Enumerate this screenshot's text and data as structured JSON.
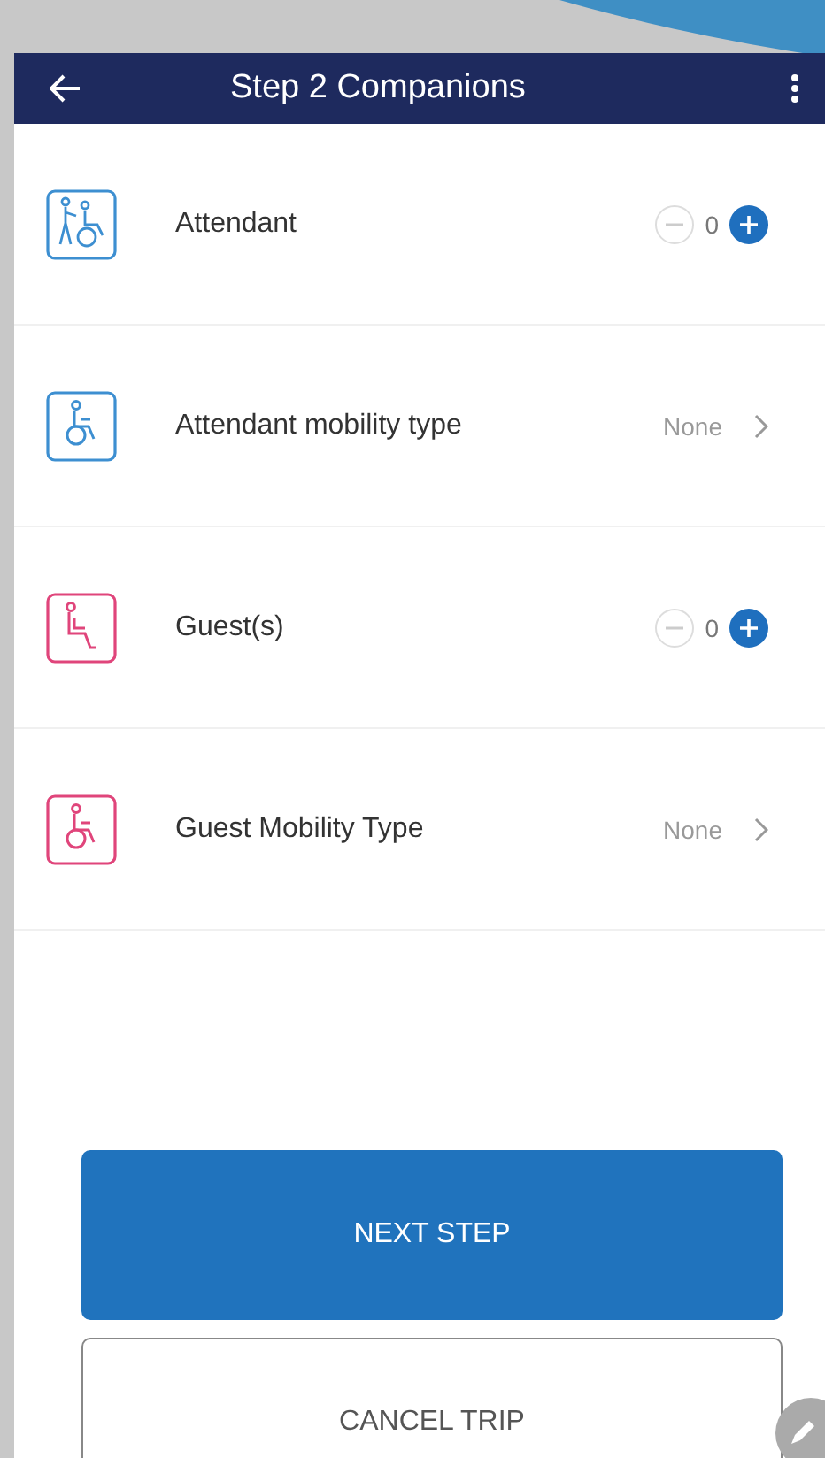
{
  "app_bar": {
    "title": "Step 2 Companions"
  },
  "rows": [
    {
      "kind": "counter",
      "icon": {
        "kind": "pusher"
      },
      "color": "#3d8fd1",
      "label": "Attendant",
      "value": "0",
      "minus_disabled": true
    },
    {
      "kind": "select",
      "icon": {
        "kind": "wheelchair"
      },
      "color": "#3d8fd1",
      "label": "Attendant mobility type",
      "value": "None"
    },
    {
      "kind": "counter",
      "icon": {
        "kind": "seat"
      },
      "color": "#e0457b",
      "label": "Guest(s)",
      "value": "0",
      "minus_disabled": true
    },
    {
      "kind": "select",
      "icon": {
        "kind": "wheelchair"
      },
      "color": "#e0457b",
      "label": "Guest Mobility Type",
      "value": "None"
    }
  ],
  "buttons": {
    "next": "NEXT STEP",
    "cancel": "CANCEL TRIP"
  }
}
